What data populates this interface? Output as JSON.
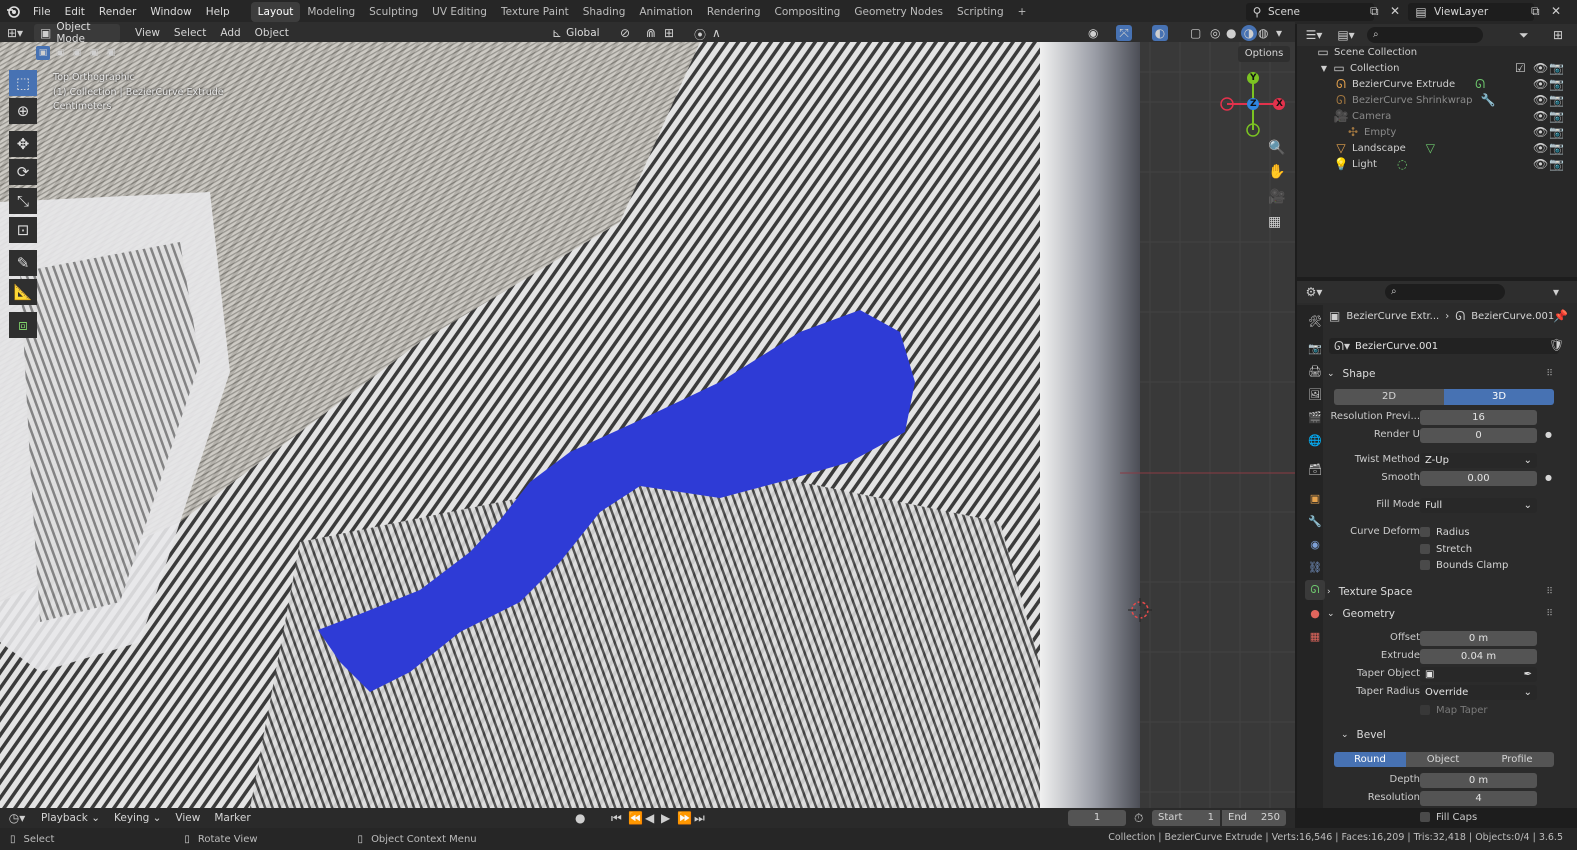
{
  "menubar": {
    "items": [
      "File",
      "Edit",
      "Render",
      "Window",
      "Help"
    ],
    "workspaces": [
      "Layout",
      "Modeling",
      "Sculpting",
      "UV Editing",
      "Texture Paint",
      "Shading",
      "Animation",
      "Rendering",
      "Compositing",
      "Geometry Nodes",
      "Scripting"
    ],
    "active_workspace": "Layout",
    "add_tab": "+",
    "scene": "Scene",
    "view_layer": "ViewLayer"
  },
  "viewport_header": {
    "mode": "Object Mode",
    "menus": [
      "View",
      "Select",
      "Add",
      "Object"
    ],
    "orientation": "Global",
    "options": "Options"
  },
  "viewport": {
    "view_name": "Top Orthographic",
    "collection_info": "(1) Collection | BezierCurve Extrude",
    "units": "Centimeters",
    "gizmo": {
      "x": "X",
      "y": "Y",
      "z": "Z"
    },
    "colors": {
      "blue_shape": "#2e3bd6",
      "axis_x": "#e2324c",
      "axis_y": "#7bc322",
      "axis_z": "#2f86e0"
    }
  },
  "outliner": {
    "root": "Scene Collection",
    "collection": "Collection",
    "items": [
      {
        "name": "BezierCurve Extrude",
        "icon": "curve-icon",
        "visible": true
      },
      {
        "name": "BezierCurve Shrinkwrap",
        "icon": "curve-icon",
        "visible": true
      },
      {
        "name": "Camera",
        "icon": "camera-icon",
        "visible": true
      },
      {
        "name": "Empty",
        "icon": "empty-icon",
        "visible": true
      },
      {
        "name": "Landscape",
        "icon": "mesh-icon",
        "visible": true
      },
      {
        "name": "Light",
        "icon": "light-icon",
        "visible": true
      }
    ]
  },
  "properties": {
    "breadcrumb_object": "BezierCurve Extr...",
    "breadcrumb_data": "BezierCurve.001",
    "datablock_name": "BezierCurve.001",
    "shape": {
      "title": "Shape",
      "dim_2d": "2D",
      "dim_3d": "3D",
      "resolution_preview_label": "Resolution Previ...",
      "resolution_preview": "16",
      "render_u_label": "Render U",
      "render_u": "0",
      "twist_method_label": "Twist Method",
      "twist_method": "Z-Up",
      "smooth_label": "Smooth",
      "smooth": "0.00",
      "fill_mode_label": "Fill Mode",
      "fill_mode": "Full",
      "curve_deform_label": "Curve Deform",
      "radius": "Radius",
      "stretch": "Stretch",
      "bounds_clamp": "Bounds Clamp"
    },
    "texture_space": "Texture Space",
    "geometry": {
      "title": "Geometry",
      "offset_label": "Offset",
      "offset": "0 m",
      "extrude_label": "Extrude",
      "extrude": "0.04 m",
      "taper_object_label": "Taper Object",
      "taper_radius_label": "Taper Radius",
      "taper_radius": "Override",
      "map_taper": "Map Taper"
    },
    "bevel": {
      "title": "Bevel",
      "round": "Round",
      "object": "Object",
      "profile": "Profile",
      "depth_label": "Depth",
      "depth": "0 m",
      "resolution_label": "Resolution",
      "resolution": "4",
      "fill_caps": "Fill Caps"
    }
  },
  "timeline": {
    "menus": [
      "Playback",
      "Keying",
      "View",
      "Marker"
    ],
    "current_frame": "1",
    "start_label": "Start",
    "start": "1",
    "end_label": "End",
    "end": "250"
  },
  "statusbar": {
    "select": "Select",
    "rotate": "Rotate View",
    "context": "Object Context Menu",
    "stats": "Collection | BezierCurve Extrude | Verts:16,546 | Faces:16,209 | Tris:32,418 | Objects:0/4 | 3.6.5"
  }
}
